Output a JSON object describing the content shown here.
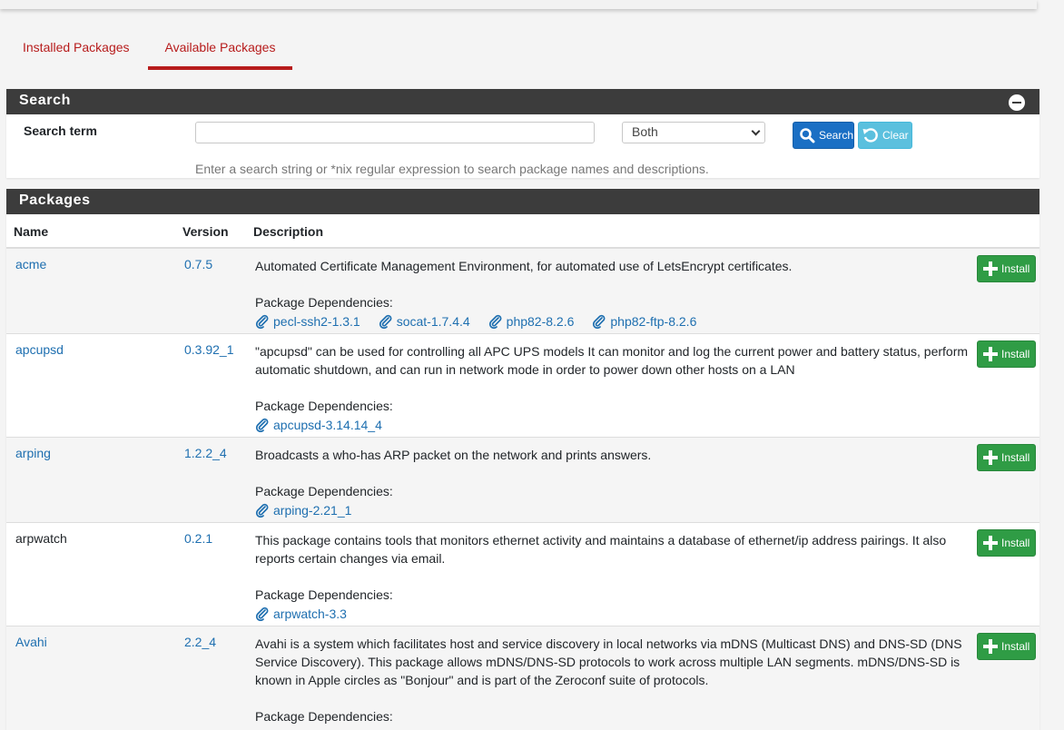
{
  "tabs": [
    {
      "label": "Installed Packages"
    },
    {
      "label": "Available Packages"
    }
  ],
  "search_panel": {
    "title": "Search",
    "term_label": "Search term",
    "term_value": "",
    "scope_selected": "Both",
    "search_button": "Search",
    "clear_button": "Clear",
    "help_text": "Enter a search string or *nix regular expression to search package names and descriptions."
  },
  "packages_panel": {
    "title": "Packages",
    "columns": {
      "name": "Name",
      "version": "Version",
      "description": "Description"
    },
    "dependencies_label": "Package Dependencies:",
    "install_label": "Install",
    "rows": [
      {
        "name": "acme",
        "version": "0.7.5",
        "description": "Automated Certificate Management Environment, for automated use of LetsEncrypt certificates.",
        "deps": [
          "pecl-ssh2-1.3.1",
          "socat-1.7.4.4",
          "php82-8.2.6",
          "php82-ftp-8.2.6"
        ]
      },
      {
        "name": "apcupsd",
        "version": "0.3.92_1",
        "description": "\"apcupsd\" can be used for controlling all APC UPS models It can monitor and log the current power and battery status, perform automatic shutdown, and can run in network mode in order to power down other hosts on a LAN",
        "deps": [
          "apcupsd-3.14.14_4"
        ]
      },
      {
        "name": "arping",
        "version": "1.2.2_4",
        "description": "Broadcasts a who-has ARP packet on the network and prints answers.",
        "deps": [
          "arping-2.21_1"
        ]
      },
      {
        "name": "arpwatch",
        "version": "0.2.1",
        "description": "This package contains tools that monitors ethernet activity and maintains a database of ethernet/ip address pairings. It also reports certain changes via email.",
        "deps": [
          "arpwatch-3.3"
        ]
      },
      {
        "name": "Avahi",
        "version": "2.2_4",
        "description": "Avahi is a system which facilitates host and service discovery in local networks via mDNS (Multicast DNS) and DNS-SD (DNS Service Discovery). This package allows mDNS/DNS-SD protocols to work across multiple LAN segments. mDNS/DNS-SD is known in Apple circles as \"Bonjour\" and is part of the Zeroconf suite of protocols.",
        "deps": []
      }
    ]
  }
}
